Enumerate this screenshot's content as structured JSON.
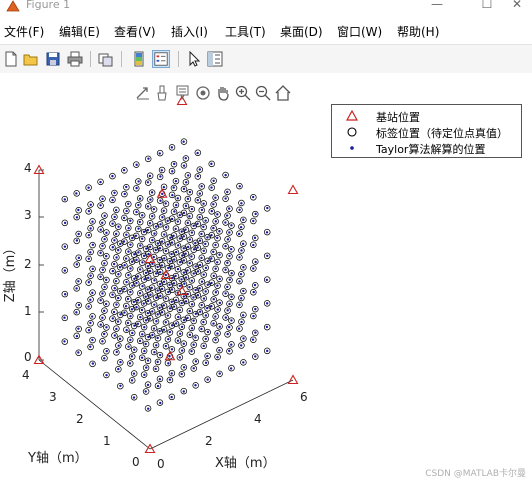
{
  "window": {
    "title": "Figure 1",
    "buttons": [
      "—",
      "☐",
      "✕"
    ]
  },
  "menu": [
    "文件(F)",
    "编辑(E)",
    "查看(V)",
    "插入(I)",
    "工具(T)",
    "桌面(D)",
    "窗口(W)",
    "帮助(H)"
  ],
  "toolbar_icons": [
    "new-figure-icon",
    "open-file-icon",
    "save-icon",
    "print-icon",
    "link-plot-icon",
    "colorbar-icon",
    "legend-icon",
    "edit-plot-arrow-icon",
    "property-inspector-icon"
  ],
  "axes_toolbar_icons": [
    "export-icon",
    "brush-icon",
    "datatip-icon",
    "rotate-3d-icon",
    "pan-hand-icon",
    "zoom-in-icon",
    "zoom-out-icon",
    "home-icon"
  ],
  "legend": [
    {
      "symbol": "triangle",
      "color": "#cc2222",
      "label": "基站位置"
    },
    {
      "symbol": "circle",
      "color": "#000000",
      "label": "标签位置（待定位点真值）"
    },
    {
      "symbol": "dot",
      "color": "#1a1aa0",
      "label": "Taylor算法解算的位置"
    }
  ],
  "chart_data": {
    "type": "scatter",
    "title": "",
    "xlabel": "X轴（m）",
    "ylabel": "Y轴（m）",
    "zlabel": "Z轴（m）",
    "xlim": [
      0,
      6
    ],
    "ylim": [
      0,
      4
    ],
    "zlim": [
      0,
      4
    ],
    "xticks": [
      0,
      2,
      4,
      6
    ],
    "yticks": [
      0,
      1,
      2,
      3,
      4
    ],
    "zticks": [
      0,
      1,
      2,
      3,
      4
    ],
    "grid": false,
    "legend_position": "top-right",
    "anchors": [
      [
        0,
        0,
        0
      ],
      [
        6,
        0,
        0
      ],
      [
        6,
        4,
        0
      ],
      [
        0,
        4,
        0
      ],
      [
        0,
        0,
        4
      ],
      [
        6,
        0,
        4
      ],
      [
        6,
        4,
        4
      ],
      [
        0,
        4,
        4
      ],
      [
        3,
        2,
        2
      ],
      [
        2,
        1,
        1
      ],
      [
        4,
        3,
        3
      ]
    ],
    "tags_grid": {
      "x_values": [
        0.5,
        1,
        1.5,
        2,
        2.5,
        3,
        3.5,
        4,
        4.5,
        5,
        5.5
      ],
      "y_values": [
        0.5,
        1,
        1.5,
        2,
        2.5,
        3,
        3.5
      ],
      "z_values": [
        0.5,
        1,
        1.5,
        2,
        2.5,
        3,
        3.5
      ]
    },
    "series": [
      {
        "name": "基站位置",
        "marker": "triangle"
      },
      {
        "name": "标签位置（待定位点真值）",
        "marker": "circle"
      },
      {
        "name": "Taylor算法解算的位置",
        "marker": "dot"
      }
    ]
  },
  "watermark": "CSDN @MATLAB卡尔曼"
}
